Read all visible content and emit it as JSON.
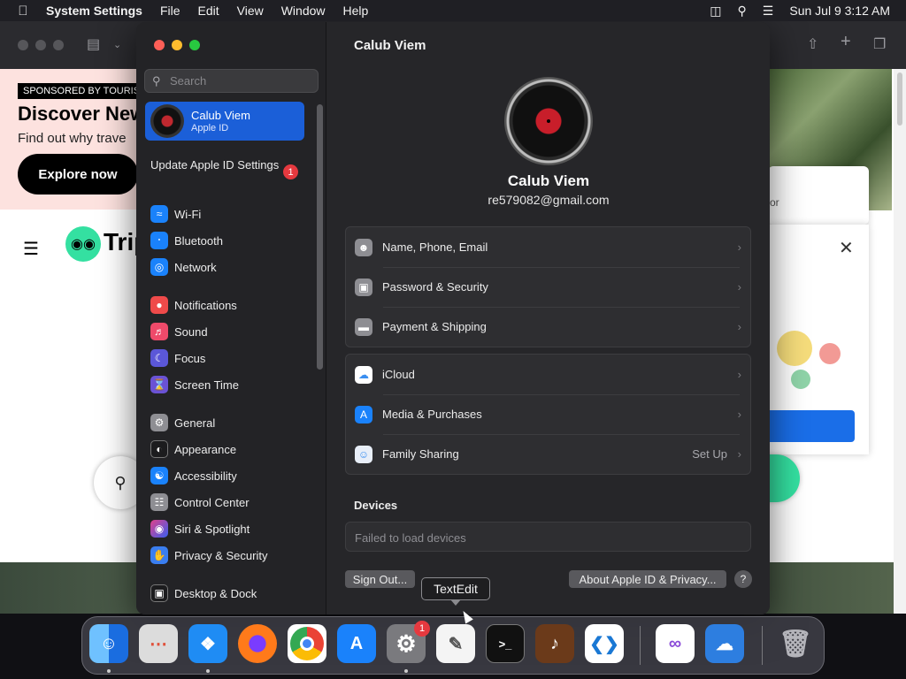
{
  "menubar": {
    "app_name": "System Settings",
    "items": [
      "File",
      "Edit",
      "View",
      "Window",
      "Help"
    ],
    "clock": "Sun Jul 9  3:12 AM"
  },
  "browser": {
    "sponsor": "SPONSORED BY TOURIS",
    "headline": "Discover New",
    "subtitle": "Find out why trave",
    "cta": "Explore now",
    "logo_text": "Trip",
    "popup_text": "or"
  },
  "sidebar": {
    "search_placeholder": "Search",
    "account": {
      "name": "Calub Viem",
      "sub": "Apple ID"
    },
    "update": {
      "label": "Update Apple ID Settings",
      "badge": "1"
    },
    "items": [
      {
        "label": "Wi-Fi",
        "icon": "wifi-icon",
        "color": "#1a82fb"
      },
      {
        "label": "Bluetooth",
        "icon": "bluetooth-icon",
        "color": "#1a82fb"
      },
      {
        "label": "Network",
        "icon": "globe-icon",
        "color": "#1a82fb"
      },
      {
        "label": "Notifications",
        "icon": "bell-icon",
        "color": "#ef4a4a"
      },
      {
        "label": "Sound",
        "icon": "speaker-icon",
        "color": "#ef4a6a"
      },
      {
        "label": "Focus",
        "icon": "moon-icon",
        "color": "#5b57d8"
      },
      {
        "label": "Screen Time",
        "icon": "hourglass-icon",
        "color": "#6a52d4"
      },
      {
        "label": "General",
        "icon": "gear-icon",
        "color": "#8e8e93"
      },
      {
        "label": "Appearance",
        "icon": "appearance-icon",
        "color": "#1c1c1e"
      },
      {
        "label": "Accessibility",
        "icon": "accessibility-icon",
        "color": "#1a82fb"
      },
      {
        "label": "Control Center",
        "icon": "control-center-icon",
        "color": "#8e8e93"
      },
      {
        "label": "Siri & Spotlight",
        "icon": "siri-icon",
        "color": "#a040c0"
      },
      {
        "label": "Privacy & Security",
        "icon": "hand-icon",
        "color": "#3a7ef0"
      },
      {
        "label": "Desktop & Dock",
        "icon": "dock-icon",
        "color": "#1c1c1e"
      }
    ]
  },
  "content": {
    "title": "Calub Viem",
    "name": "Calub Viem",
    "email": "re579082@gmail.com",
    "group1": [
      {
        "label": "Name, Phone, Email",
        "icon": "person-icon",
        "color": "#8e8e93"
      },
      {
        "label": "Password & Security",
        "icon": "lock-icon",
        "color": "#8e8e93"
      },
      {
        "label": "Payment & Shipping",
        "icon": "card-icon",
        "color": "#8e8e93"
      }
    ],
    "group2": [
      {
        "label": "iCloud",
        "icon": "cloud-icon",
        "color": "#ffffff"
      },
      {
        "label": "Media & Purchases",
        "icon": "app-store-icon",
        "color": "#1a82fb"
      },
      {
        "label": "Family Sharing",
        "icon": "family-icon",
        "color": "#e8eef8",
        "value": "Set Up"
      }
    ],
    "devices_heading": "Devices",
    "devices_status": "Failed to load devices",
    "sign_out": "Sign Out...",
    "about": "About Apple ID & Privacy...",
    "help": "?"
  },
  "tooltip": "TextEdit",
  "dock": {
    "settings_badge": "1",
    "apps": [
      {
        "name": "Finder",
        "icon": "finder-icon",
        "color": "#2a8cf0"
      },
      {
        "name": "Launchpad",
        "icon": "launchpad-icon",
        "color": "#dcdcdc"
      },
      {
        "name": "Safari",
        "icon": "safari-icon",
        "color": "#1f8cf4"
      },
      {
        "name": "Firefox",
        "icon": "firefox-icon",
        "color": "#ff7a1a"
      },
      {
        "name": "Chrome",
        "icon": "chrome-icon",
        "color": "#ffffff"
      },
      {
        "name": "App Store",
        "icon": "app-store-icon",
        "color": "#1a82fb"
      },
      {
        "name": "System Settings",
        "icon": "gear-icon",
        "color": "#7a7a7e"
      },
      {
        "name": "TextEdit",
        "icon": "textedit-icon",
        "color": "#f4f4f4"
      },
      {
        "name": "Terminal",
        "icon": "terminal-icon",
        "color": "#111111"
      },
      {
        "name": "GarageBand",
        "icon": "guitar-icon",
        "color": "#c57a2a"
      },
      {
        "name": "Visual Studio Code",
        "icon": "vscode-icon",
        "color": "#ffffff"
      },
      {
        "name": "Visual Studio",
        "icon": "visual-studio-icon",
        "color": "#ffffff"
      },
      {
        "name": "Weather",
        "icon": "weather-icon",
        "color": "#2d7ee0"
      },
      {
        "name": "Trash",
        "icon": "trash-icon",
        "color": "#9a9aa0"
      }
    ]
  }
}
